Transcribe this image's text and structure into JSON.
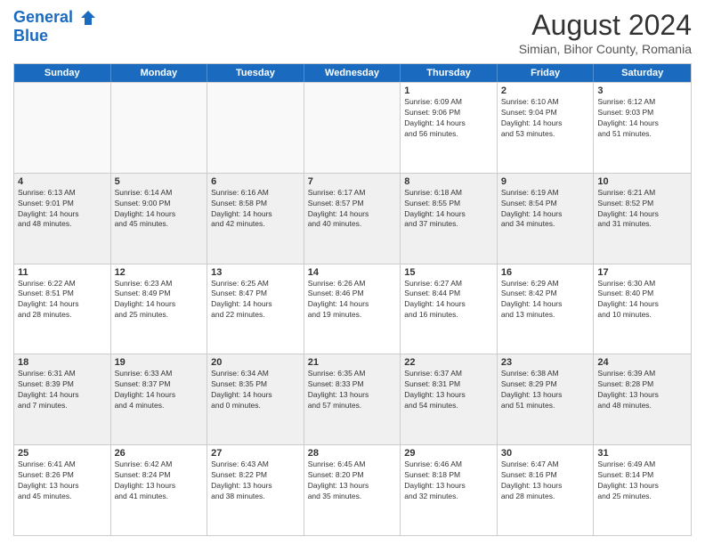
{
  "header": {
    "logo_line1": "General",
    "logo_line2": "Blue",
    "title": "August 2024",
    "subtitle": "Simian, Bihor County, Romania"
  },
  "weekdays": [
    "Sunday",
    "Monday",
    "Tuesday",
    "Wednesday",
    "Thursday",
    "Friday",
    "Saturday"
  ],
  "weeks": [
    [
      {
        "day": "",
        "info": "",
        "empty": true
      },
      {
        "day": "",
        "info": "",
        "empty": true
      },
      {
        "day": "",
        "info": "",
        "empty": true
      },
      {
        "day": "",
        "info": "",
        "empty": true
      },
      {
        "day": "1",
        "info": "Sunrise: 6:09 AM\nSunset: 9:06 PM\nDaylight: 14 hours\nand 56 minutes."
      },
      {
        "day": "2",
        "info": "Sunrise: 6:10 AM\nSunset: 9:04 PM\nDaylight: 14 hours\nand 53 minutes."
      },
      {
        "day": "3",
        "info": "Sunrise: 6:12 AM\nSunset: 9:03 PM\nDaylight: 14 hours\nand 51 minutes."
      }
    ],
    [
      {
        "day": "4",
        "info": "Sunrise: 6:13 AM\nSunset: 9:01 PM\nDaylight: 14 hours\nand 48 minutes."
      },
      {
        "day": "5",
        "info": "Sunrise: 6:14 AM\nSunset: 9:00 PM\nDaylight: 14 hours\nand 45 minutes."
      },
      {
        "day": "6",
        "info": "Sunrise: 6:16 AM\nSunset: 8:58 PM\nDaylight: 14 hours\nand 42 minutes."
      },
      {
        "day": "7",
        "info": "Sunrise: 6:17 AM\nSunset: 8:57 PM\nDaylight: 14 hours\nand 40 minutes."
      },
      {
        "day": "8",
        "info": "Sunrise: 6:18 AM\nSunset: 8:55 PM\nDaylight: 14 hours\nand 37 minutes."
      },
      {
        "day": "9",
        "info": "Sunrise: 6:19 AM\nSunset: 8:54 PM\nDaylight: 14 hours\nand 34 minutes."
      },
      {
        "day": "10",
        "info": "Sunrise: 6:21 AM\nSunset: 8:52 PM\nDaylight: 14 hours\nand 31 minutes."
      }
    ],
    [
      {
        "day": "11",
        "info": "Sunrise: 6:22 AM\nSunset: 8:51 PM\nDaylight: 14 hours\nand 28 minutes."
      },
      {
        "day": "12",
        "info": "Sunrise: 6:23 AM\nSunset: 8:49 PM\nDaylight: 14 hours\nand 25 minutes."
      },
      {
        "day": "13",
        "info": "Sunrise: 6:25 AM\nSunset: 8:47 PM\nDaylight: 14 hours\nand 22 minutes."
      },
      {
        "day": "14",
        "info": "Sunrise: 6:26 AM\nSunset: 8:46 PM\nDaylight: 14 hours\nand 19 minutes."
      },
      {
        "day": "15",
        "info": "Sunrise: 6:27 AM\nSunset: 8:44 PM\nDaylight: 14 hours\nand 16 minutes."
      },
      {
        "day": "16",
        "info": "Sunrise: 6:29 AM\nSunset: 8:42 PM\nDaylight: 14 hours\nand 13 minutes."
      },
      {
        "day": "17",
        "info": "Sunrise: 6:30 AM\nSunset: 8:40 PM\nDaylight: 14 hours\nand 10 minutes."
      }
    ],
    [
      {
        "day": "18",
        "info": "Sunrise: 6:31 AM\nSunset: 8:39 PM\nDaylight: 14 hours\nand 7 minutes."
      },
      {
        "day": "19",
        "info": "Sunrise: 6:33 AM\nSunset: 8:37 PM\nDaylight: 14 hours\nand 4 minutes."
      },
      {
        "day": "20",
        "info": "Sunrise: 6:34 AM\nSunset: 8:35 PM\nDaylight: 14 hours\nand 0 minutes."
      },
      {
        "day": "21",
        "info": "Sunrise: 6:35 AM\nSunset: 8:33 PM\nDaylight: 13 hours\nand 57 minutes."
      },
      {
        "day": "22",
        "info": "Sunrise: 6:37 AM\nSunset: 8:31 PM\nDaylight: 13 hours\nand 54 minutes."
      },
      {
        "day": "23",
        "info": "Sunrise: 6:38 AM\nSunset: 8:29 PM\nDaylight: 13 hours\nand 51 minutes."
      },
      {
        "day": "24",
        "info": "Sunrise: 6:39 AM\nSunset: 8:28 PM\nDaylight: 13 hours\nand 48 minutes."
      }
    ],
    [
      {
        "day": "25",
        "info": "Sunrise: 6:41 AM\nSunset: 8:26 PM\nDaylight: 13 hours\nand 45 minutes."
      },
      {
        "day": "26",
        "info": "Sunrise: 6:42 AM\nSunset: 8:24 PM\nDaylight: 13 hours\nand 41 minutes."
      },
      {
        "day": "27",
        "info": "Sunrise: 6:43 AM\nSunset: 8:22 PM\nDaylight: 13 hours\nand 38 minutes."
      },
      {
        "day": "28",
        "info": "Sunrise: 6:45 AM\nSunset: 8:20 PM\nDaylight: 13 hours\nand 35 minutes."
      },
      {
        "day": "29",
        "info": "Sunrise: 6:46 AM\nSunset: 8:18 PM\nDaylight: 13 hours\nand 32 minutes."
      },
      {
        "day": "30",
        "info": "Sunrise: 6:47 AM\nSunset: 8:16 PM\nDaylight: 13 hours\nand 28 minutes."
      },
      {
        "day": "31",
        "info": "Sunrise: 6:49 AM\nSunset: 8:14 PM\nDaylight: 13 hours\nand 25 minutes."
      }
    ]
  ]
}
